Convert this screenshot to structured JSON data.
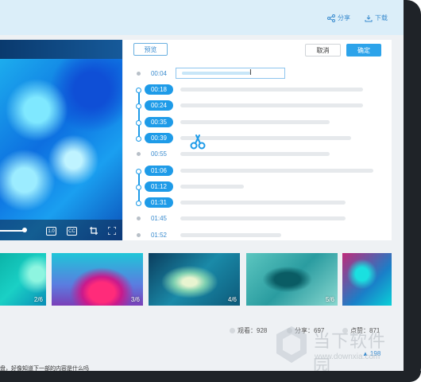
{
  "header": {
    "share_label": "分享",
    "download_label": "下载"
  },
  "editor": {
    "preview_label": "预览",
    "cancel_label": "取消",
    "confirm_label": "确定",
    "segments": [
      {
        "time": "00:04",
        "selected": false
      },
      {
        "time": "00:18",
        "selected": true
      },
      {
        "time": "00:24",
        "selected": true
      },
      {
        "time": "00:35",
        "selected": true
      },
      {
        "time": "00:39",
        "selected": true
      },
      {
        "time": "00:55",
        "selected": false
      },
      {
        "time": "01:06",
        "selected": true
      },
      {
        "time": "01:12",
        "selected": true
      },
      {
        "time": "01:31",
        "selected": true
      },
      {
        "time": "01:45",
        "selected": false
      },
      {
        "time": "01:52",
        "selected": false
      }
    ]
  },
  "player": {
    "controls": [
      "progress-slider",
      "quality-icon",
      "subtitle-icon",
      "crop-icon",
      "fullscreen-icon"
    ],
    "quality_label": "1.0",
    "subtitle_label": "CC"
  },
  "thumbnails": [
    {
      "badge": "2/6"
    },
    {
      "badge": "3/6"
    },
    {
      "badge": "4/6"
    },
    {
      "badge": "5/6"
    },
    {
      "badge": ""
    }
  ],
  "stats": {
    "views": "观看：928",
    "shares": "分享：697",
    "likes": "点赞：871",
    "like_count": "198"
  },
  "description": "盘，好像知道下一部的内容是什么吗",
  "watermark": {
    "title": "当下软件园",
    "url": "www.downxia.com"
  },
  "colors": {
    "accent": "#1e9be8",
    "topbar": "#dbeef9",
    "frame": "#1f2328"
  }
}
